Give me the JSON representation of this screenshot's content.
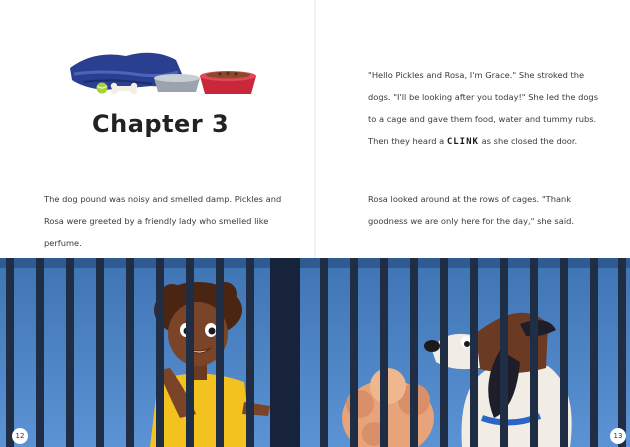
{
  "chapter": {
    "title": "Chapter 3"
  },
  "left_page": {
    "paragraph": "The dog pound was noisy and smelled damp. Pickles and Rosa were greeted by a friendly lady who smelled like perfume.",
    "page_number": "12"
  },
  "right_page": {
    "paragraph_1_before": "\"Hello Pickles and Rosa, I'm Grace.\" She stroked the dogs. \"I'll be looking after you today!\" She led the dogs to a cage and gave them food, water and tummy rubs. Then they heard a ",
    "clink": "CLINK",
    "paragraph_1_after": " as she closed the door.",
    "paragraph_2": "Rosa looked around at the rows of cages. \"Thank goodness we are only here for the day,\" she said.",
    "page_number": "13"
  },
  "colors": {
    "background": "#ffffff",
    "sky_blue": "#4a7fc0",
    "bar_dark": "#1f2e44",
    "bowl_red": "#c8283a",
    "blanket_blue": "#2a3f8f",
    "shirt_yellow": "#f4c21f"
  },
  "icons": [
    "blanket-icon",
    "dog-bowl-icon",
    "bone-icon",
    "ball-icon"
  ]
}
